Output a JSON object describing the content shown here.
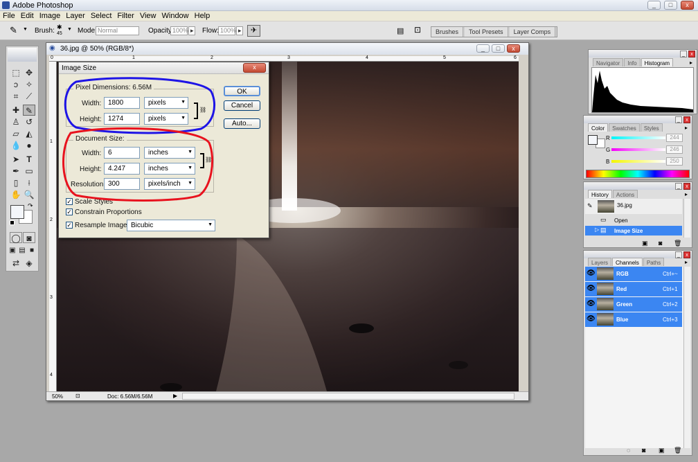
{
  "app": {
    "title": "Adobe Photoshop"
  },
  "window_controls": {
    "min": "_",
    "max": "□",
    "close": "x"
  },
  "menu": [
    "File",
    "Edit",
    "Image",
    "Layer",
    "Select",
    "Filter",
    "View",
    "Window",
    "Help"
  ],
  "options": {
    "brush_label": "Brush:",
    "brush_size": "45",
    "mode_label": "Mode:",
    "mode_value": "Normal",
    "opacity_label": "Opacity:",
    "opacity_value": "100%",
    "flow_label": "Flow:",
    "flow_value": "100%",
    "wells": [
      "Brushes",
      "Tool Presets",
      "Layer Comps"
    ]
  },
  "document": {
    "title": "36.jpg @ 50% (RGB/8*)",
    "zoom": "50%",
    "doc_size": "Doc: 6.56M/6.56M",
    "ruler_top": [
      "0",
      "1",
      "2",
      "3",
      "4",
      "5",
      "6"
    ],
    "ruler_left": [
      "1",
      "2",
      "3",
      "4"
    ]
  },
  "dialog": {
    "title": "Image Size",
    "pixel_dimensions_label": "Pixel Dimensions:",
    "pixel_dimensions_value": "6.56M",
    "width_label": "Width:",
    "width_px": "1800",
    "width_px_unit": "pixels",
    "height_label": "Height:",
    "height_px": "1274",
    "height_px_unit": "pixels",
    "document_size_label": "Document Size:",
    "doc_width": "6",
    "doc_width_unit": "inches",
    "doc_height": "4.247",
    "doc_height_unit": "inches",
    "resolution_label": "Resolution:",
    "resolution": "300",
    "resolution_unit": "pixels/inch",
    "scale_styles": "Scale Styles",
    "constrain": "Constrain Proportions",
    "resample": "Resample Image:",
    "resample_method": "Bicubic",
    "ok": "OK",
    "cancel": "Cancel",
    "auto": "Auto...",
    "check_mark": "✓"
  },
  "panels": {
    "nav_tabs": [
      "Navigator",
      "Info",
      "Histogram"
    ],
    "color_tabs": [
      "Color",
      "Swatches",
      "Styles"
    ],
    "color_channels": [
      {
        "label": "R",
        "value": "244",
        "fill": 0.957
      },
      {
        "label": "G",
        "value": "246",
        "fill": 0.965
      },
      {
        "label": "B",
        "value": "250",
        "fill": 0.98
      }
    ],
    "history_tabs": [
      "History",
      "Actions"
    ],
    "history_snapshot": "36.jpg",
    "history_items": [
      "Open",
      "Image Size"
    ],
    "layer_tabs": [
      "Layers",
      "Channels",
      "Paths"
    ],
    "channels": [
      {
        "name": "RGB",
        "shortcut": "Ctrl+~"
      },
      {
        "name": "Red",
        "shortcut": "Ctrl+1"
      },
      {
        "name": "Green",
        "shortcut": "Ctrl+2"
      },
      {
        "name": "Blue",
        "shortcut": "Ctrl+3"
      }
    ]
  },
  "colors": {
    "accent": "#3b86f2",
    "annotation_blue": "#1e14e6",
    "annotation_red": "#e8121e"
  }
}
